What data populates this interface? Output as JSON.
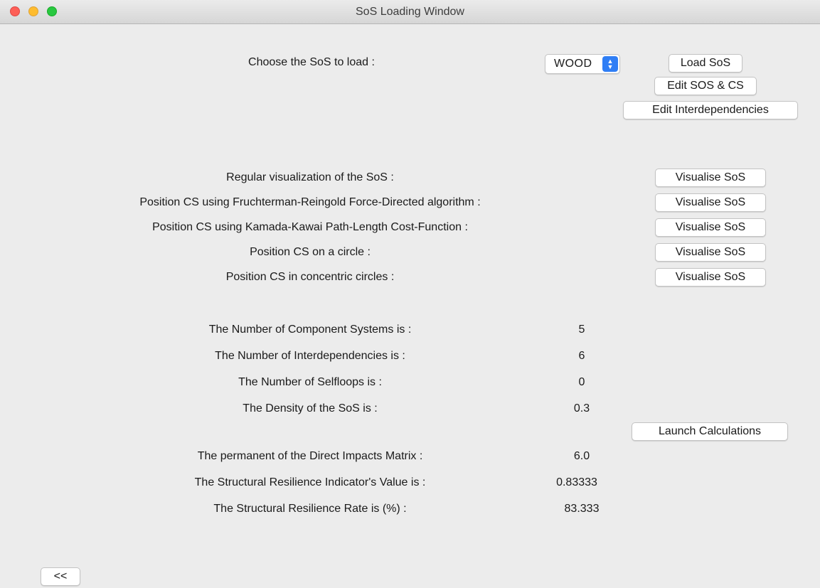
{
  "window": {
    "title": "SoS Loading Window"
  },
  "load_section": {
    "choose_label": "Choose the SoS to load :",
    "selected_sos": "WOOD",
    "load_button": "Load SoS",
    "edit_sos_cs_button": "Edit SOS & CS",
    "edit_interdependencies_button": "Edit Interdependencies"
  },
  "visualisation": {
    "rows": [
      {
        "label": "Regular visualization of the SoS :",
        "button": "Visualise SoS"
      },
      {
        "label": "Position CS using Fruchterman-Reingold Force-Directed algorithm :",
        "button": "Visualise SoS"
      },
      {
        "label": "Position CS using Kamada-Kawai Path-Length Cost-Function :",
        "button": "Visualise SoS"
      },
      {
        "label": "Position CS on a circle :",
        "button": "Visualise SoS"
      },
      {
        "label": "Position CS in concentric circles :",
        "button": "Visualise SoS"
      }
    ]
  },
  "stats": {
    "component_systems_label": "The Number of Component Systems is :",
    "component_systems_value": "5",
    "interdependencies_label": "The Number of Interdependencies is :",
    "interdependencies_value": "6",
    "selfloops_label": "The Number of Selfloops is :",
    "selfloops_value": "0",
    "density_label": "The Density of the SoS is :",
    "density_value": "0.3"
  },
  "calculations": {
    "launch_button": "Launch Calculations",
    "permanent_label": "The permanent of the Direct Impacts Matrix :",
    "permanent_value": "6.0",
    "resilience_indicator_label": "The Structural Resilience Indicator's Value is :",
    "resilience_indicator_value": "0.83333",
    "resilience_rate_label": "The Structural Resilience Rate is (%) :",
    "resilience_rate_value": "83.333"
  },
  "footer": {
    "back_button": "<<"
  }
}
